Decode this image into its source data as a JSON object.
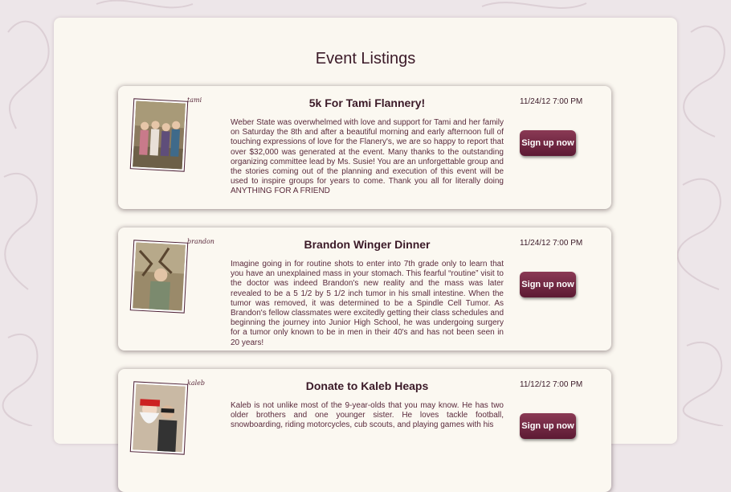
{
  "page": {
    "title": "Event Listings"
  },
  "events": [
    {
      "photo_caption": "tami",
      "title": "5k For Tami Flannery!",
      "date": "11/24/12 7:00 PM",
      "description": "Weber State was overwhelmed with love and support for Tami and her family on Saturday the 8th and after a beautiful morning and early afternoon full of touching expressions of love for the Flanery's, we are so happy to report that over $32,000 was generated at the event. Many thanks to the outstanding organizing committee lead by Ms. Susie! You are an unforgettable group and the stories coming out of the planning and execution of this event will be used to inspire groups for years to come. Thank you all for literally doing ANYTHING FOR A FRIEND",
      "button": "Sign up now"
    },
    {
      "photo_caption": "brandon",
      "title": "Brandon Winger Dinner",
      "date": "11/24/12 7:00 PM",
      "description": "Imagine going in for routine shots to enter into 7th grade only to learn that you have an unexplained mass in your stomach. This fearful “routine” visit to the doctor was indeed Brandon's new reality and the mass was later revealed to be a 5 1/2 by 5 1/2 inch tumor in his small intestine. When the tumor was removed, it was determined to be a Spindle Cell Tumor. As Brandon's fellow classmates were excitedly getting their class schedules and beginning the journey into Junior High School, he was undergoing surgery for a tumor only known to be in men in their 40's and has not been seen in 20 years!",
      "button": "Sign up now"
    },
    {
      "photo_caption": "kaleb",
      "title": "Donate to Kaleb Heaps",
      "date": "11/12/12 7:00 PM",
      "description": "Kaleb is not unlike most of the 9-year-olds that you may know. He has two older brothers and one younger sister. He loves tackle football, snowboarding, riding motorcycles, cub scouts, and playing games with his",
      "button": "Sign up now"
    }
  ],
  "colors": {
    "accent": "#6b2440",
    "text": "#5a2a3c",
    "panel": "#faf7f0",
    "background": "#ede6e9"
  }
}
